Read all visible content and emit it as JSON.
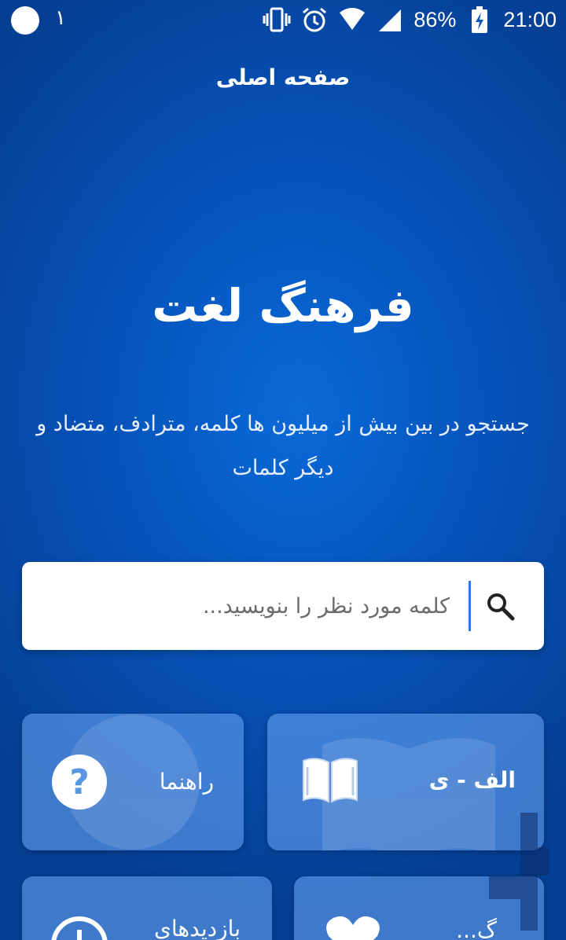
{
  "status_bar": {
    "notification_count": "١",
    "battery_percent": "86%",
    "time": "21:00",
    "icons": [
      "vibrate-icon",
      "alarm-icon",
      "wifi-icon",
      "signal-icon",
      "battery-charging-icon"
    ]
  },
  "header": {
    "title": "صفحه اصلی"
  },
  "hero": {
    "app_title": "فرهنگ لغت",
    "description": "جستجو در بین بیش از میلیون ها کلمه، مترادف، متضاد و دیگر کلمات"
  },
  "search": {
    "placeholder": "کلمه مورد نظر را بنویسید...",
    "value": "",
    "icon": "search-icon"
  },
  "tiles": [
    {
      "label": "الف - ی",
      "icon": "book-icon"
    },
    {
      "label": "راهنما",
      "icon": "help-icon"
    },
    {
      "label": "گ...",
      "icon": "heart-icon"
    },
    {
      "label": "بازدیدهای",
      "icon": "history-icon"
    }
  ],
  "colors": {
    "background": "#0654bb",
    "tile": "#6eaafa",
    "caret": "#2c7be5"
  }
}
